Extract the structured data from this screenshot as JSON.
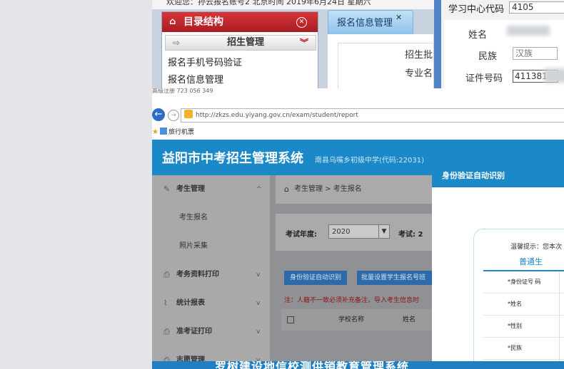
{
  "legacy_window": {
    "welcome_text": "欢迎您：孙云报名账号2   北京时间 2019年6月24日 星期六",
    "left_panel_title": "目录结构",
    "section_title": "招生管理",
    "menu_items": [
      "报名手机号码验证",
      "报名信息管理"
    ],
    "active_tab": "报名信息管理",
    "center_labels": [
      "招生批",
      "专业名"
    ],
    "right_form": {
      "center_code_label": "学习中心代码",
      "center_code_value": "4105",
      "name_label": "姓名",
      "ethnicity_label": "民族",
      "ethnicity_value": "汉族",
      "id_label": "证件号码",
      "id_value": "411381"
    }
  },
  "browser": {
    "tiny_text": "高级注册  723 056 349",
    "url": "http://zkzs.edu.yiyang.gov.cn/exam/student/report",
    "favorite": "旅行机票",
    "system_title": "益阳市中考招生管理系统",
    "school_subtitle": "南县乌嘴乡初级中学(代码:22031)",
    "sidebar": {
      "items": [
        {
          "icon": "edit-icon",
          "label": "考生管理",
          "chevron": "^"
        },
        {
          "label": "考生报名"
        },
        {
          "label": "照片采集"
        },
        {
          "icon": "print-icon",
          "label": "考务资料打印",
          "chevron": "v"
        },
        {
          "icon": "chart-icon",
          "label": "统计报表",
          "chevron": "v"
        },
        {
          "icon": "print-icon",
          "label": "准考证打印",
          "chevron": "v"
        },
        {
          "icon": "print-icon",
          "label": "志愿管理",
          "chevron": "v"
        }
      ]
    },
    "breadcrumb": "考生管理  >  考生报名",
    "filter": {
      "year_label": "考试年度:",
      "year_value": "2020",
      "exam_label": "考试:  2"
    },
    "buttons": {
      "id_verify": "身份验证自动识别",
      "batch_set": "批量设置学生报名号班"
    },
    "note": "注：人籍不一致必须补充备注，导入考生信息时",
    "table_headers": [
      "学校名称",
      "姓名"
    ],
    "modal": {
      "title": "身份验证自动识别",
      "tip": "温馨提示：您本次",
      "tab": "普通生",
      "field_labels": [
        "*身份证号 码",
        "*姓名",
        "*性别",
        "*民族"
      ]
    }
  },
  "banner_text": "罗树建设地信校测供销教育管理系统"
}
